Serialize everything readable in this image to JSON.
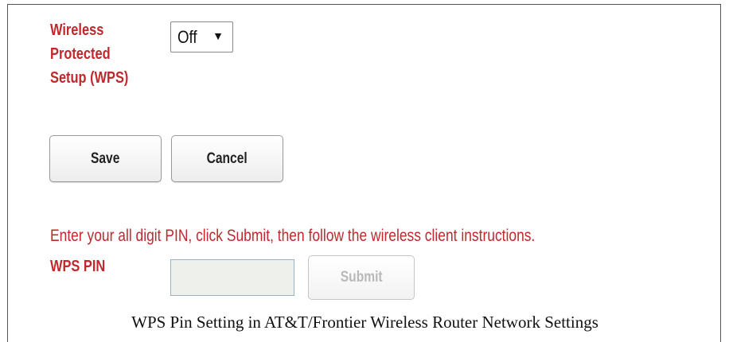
{
  "wps": {
    "label_line1": "Wireless",
    "label_line2": "Protected",
    "label_line3": "Setup (WPS)",
    "selected_value": "Off",
    "arrow_glyph": "▼"
  },
  "actions": {
    "save_label": "Save",
    "cancel_label": "Cancel"
  },
  "pin_section": {
    "instructions": "Enter your all digit PIN, click Submit, then follow the wireless client instructions.",
    "label": "WPS PIN",
    "input_value": "",
    "submit_label": "Submit"
  },
  "caption": "WPS Pin Setting in AT&T/Frontier Wireless Router Network Settings",
  "colors": {
    "label_red": "#c0282e",
    "disabled_text": "#b9b9b9",
    "input_bg": "#eef0ec"
  },
  "icons": {
    "dropdown": "chevron-down-icon"
  }
}
